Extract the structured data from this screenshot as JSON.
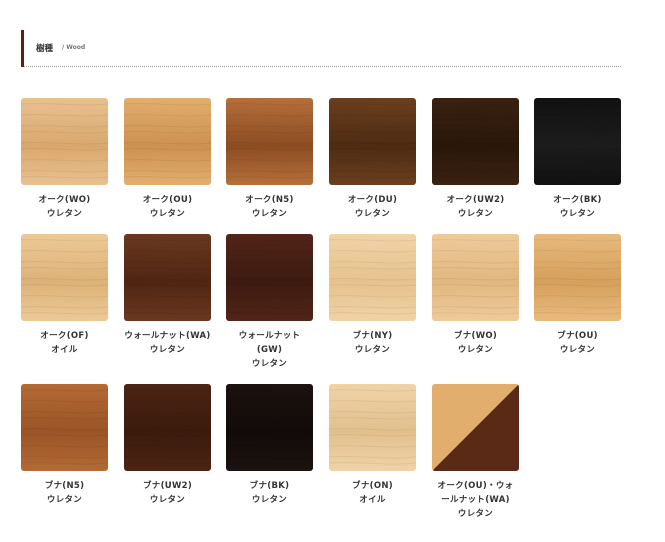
{
  "section": {
    "title": "樹種",
    "subtitle": "/ Wood"
  },
  "swatches": [
    {
      "name": "オーク(WO)",
      "finish": "ウレタン",
      "colors": [
        "#e9c18f",
        "#d9a86d"
      ]
    },
    {
      "name": "オーク(OU)",
      "finish": "ウレタン",
      "colors": [
        "#e2ae6e",
        "#cd9150"
      ]
    },
    {
      "name": "オーク(N5)",
      "finish": "ウレタン",
      "colors": [
        "#b56f3a",
        "#8c4d22"
      ]
    },
    {
      "name": "オーク(DU)",
      "finish": "ウレタン",
      "colors": [
        "#6b3f1f",
        "#4e2b12"
      ]
    },
    {
      "name": "オーク(UW2)",
      "finish": "ウレタン",
      "colors": [
        "#3a2110",
        "#2a170a"
      ]
    },
    {
      "name": "オーク(BK)",
      "finish": "ウレタン",
      "colors": [
        "#111111",
        "#1c1c1c"
      ]
    },
    {
      "name": "オーク(OF)",
      "finish": "オイル",
      "colors": [
        "#ecc996",
        "#ddb278"
      ]
    },
    {
      "name": "ウォールナット(WA)",
      "finish": "ウレタン",
      "colors": [
        "#6a3820",
        "#4f2613"
      ]
    },
    {
      "name": "ウォールナット(GW)",
      "finish": "ウレタン",
      "colors": [
        "#522518",
        "#3d1a10"
      ]
    },
    {
      "name": "ブナ(NY)",
      "finish": "ウレタン",
      "colors": [
        "#f0d3a6",
        "#e6c28e"
      ]
    },
    {
      "name": "ブナ(WO)",
      "finish": "ウレタン",
      "colors": [
        "#eecb9a",
        "#e1b77f"
      ]
    },
    {
      "name": "ブナ(OU)",
      "finish": "ウレタン",
      "colors": [
        "#e7ba7c",
        "#d69f5c"
      ]
    },
    {
      "name": "ブナ(N5)",
      "finish": "ウレタン",
      "colors": [
        "#b46a34",
        "#9a5427"
      ]
    },
    {
      "name": "ブナ(UW2)",
      "finish": "ウレタン",
      "colors": [
        "#4c2414",
        "#3b1b0d"
      ]
    },
    {
      "name": "ブナ(BK)",
      "finish": "ウレタン",
      "colors": [
        "#1c1210",
        "#120b09"
      ]
    },
    {
      "name": "ブナ(ON)",
      "finish": "オイル",
      "colors": [
        "#efd3a7",
        "#e2c08e"
      ]
    },
    {
      "name": "オーク(OU)・ウォールナット(WA)",
      "finish": "ウレタン",
      "colors": [
        "#e2ae6e",
        "#5a2a17"
      ],
      "split": true
    }
  ]
}
